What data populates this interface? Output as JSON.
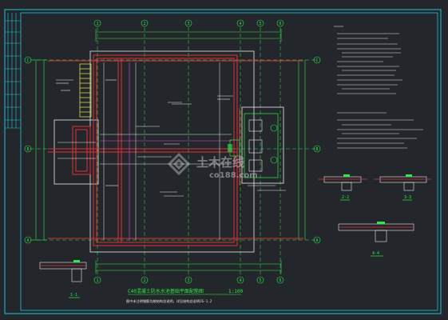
{
  "drawing": {
    "title": "C40混凝土防水水池基础平面配筋图",
    "scale": "1:100",
    "subtitle": "图中未注明钢筋均按结构总说明，详见结构总说明JG-1.2"
  },
  "axes": {
    "columns": [
      "1",
      "2",
      "3",
      "4",
      "5",
      "6",
      "7"
    ],
    "rows": [
      "A",
      "B",
      "C"
    ]
  },
  "sections": [
    "2-2",
    "3-3",
    "1-1",
    "4-4"
  ],
  "watermark": {
    "text": "土木在线",
    "sub": "co188.com"
  },
  "colors": {
    "background": "#23272b",
    "frame": "#19c7d9",
    "grid_green": "#2ee84a",
    "wall_red": "#e0303a",
    "rebar_white": "#e8e8e8",
    "accent_yellow": "#f2e64a",
    "magenta": "#d84cd8"
  }
}
